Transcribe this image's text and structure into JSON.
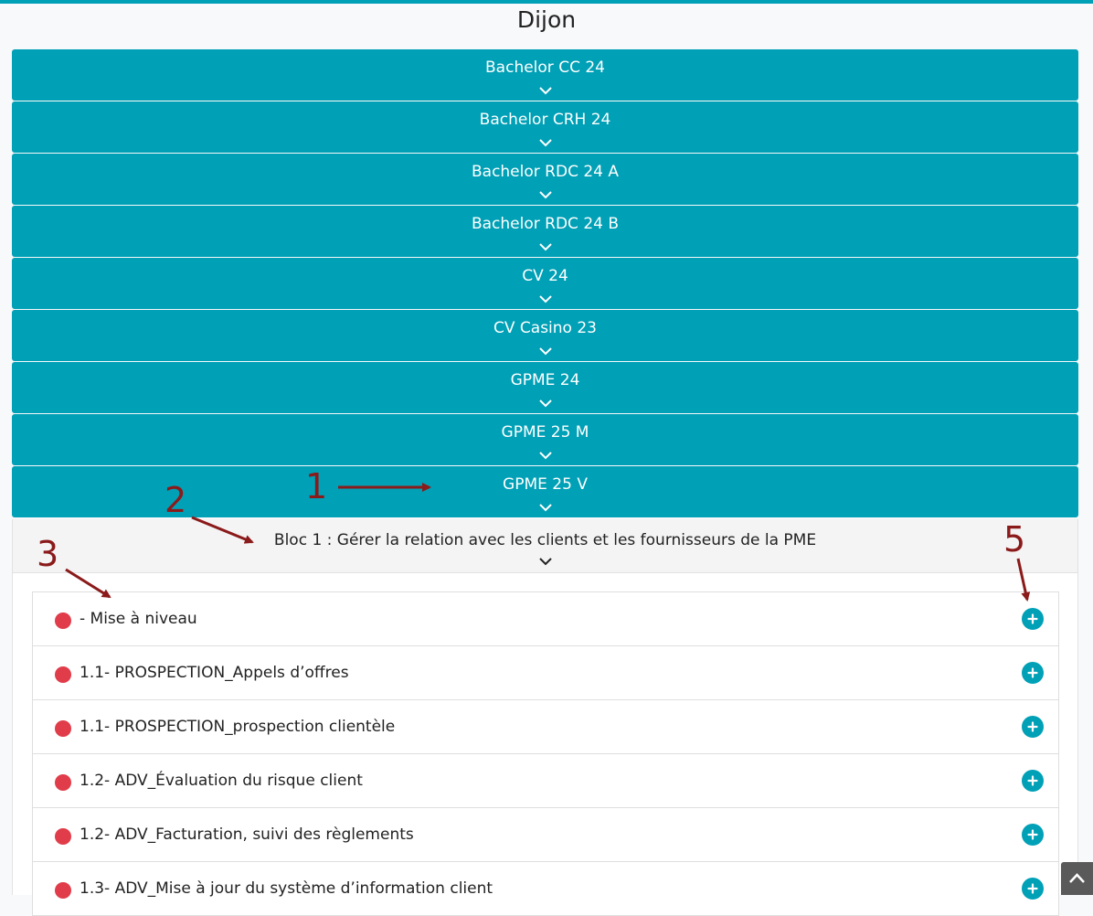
{
  "page": {
    "title": "Dijon",
    "accent_color": "#00a0b6",
    "status_red": "#e03c4a"
  },
  "groups": [
    {
      "label": "Bachelor CC 24"
    },
    {
      "label": "Bachelor CRH 24"
    },
    {
      "label": "Bachelor RDC 24 A"
    },
    {
      "label": "Bachelor RDC 24 B"
    },
    {
      "label": "CV 24"
    },
    {
      "label": "CV Casino 23"
    },
    {
      "label": "GPME 24"
    },
    {
      "label": "GPME 25 M"
    },
    {
      "label": "GPME 25 V"
    }
  ],
  "bloc": {
    "label": "Bloc 1 : Gérer la relation avec les clients et les fournisseurs de la PME"
  },
  "items": [
    {
      "label": "- Mise à niveau",
      "status": "red",
      "icon": "plus-circle-icon"
    },
    {
      "label": "1.1- PROSPECTION_Appels d’offres",
      "status": "red",
      "icon": "plus-circle-icon"
    },
    {
      "label": "1.1- PROSPECTION_prospection clientèle",
      "status": "red",
      "icon": "plus-circle-icon"
    },
    {
      "label": "1.2- ADV_Évaluation du risque client",
      "status": "red",
      "icon": "plus-circle-icon"
    },
    {
      "label": "1.2- ADV_Facturation, suivi des règlements",
      "status": "red",
      "icon": "plus-circle-icon"
    },
    {
      "label": "1.3- ADV_Mise à jour du système d’information client",
      "status": "red",
      "icon": "plus-circle-icon"
    }
  ],
  "annotations": {
    "a1": "1",
    "a2": "2",
    "a3": "3",
    "a5": "5",
    "color": "#8b1a1a"
  },
  "scroll_top": {
    "icon": "chevron-up-icon"
  }
}
